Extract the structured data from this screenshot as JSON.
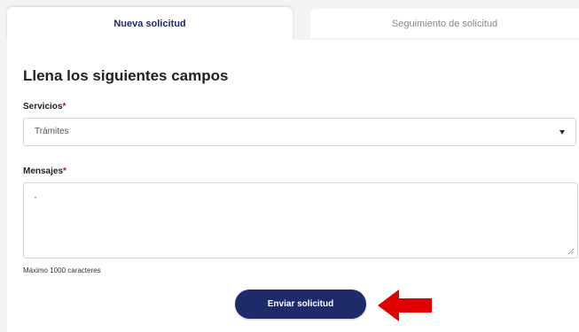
{
  "tabs": {
    "new_request": "Nueva solicitud",
    "tracking": "Seguimiento de solicitud"
  },
  "form": {
    "heading": "Llena los siguientes campos",
    "services": {
      "label": "Servicios",
      "required_mark": "*",
      "selected": "Trámites"
    },
    "messages": {
      "label": "Mensajes",
      "required_mark": "*",
      "value": "",
      "helper": "Máximo 1000 caracteres"
    },
    "submit_label": "Enviar solicitud"
  },
  "icons": {
    "select_arrow": "chevron-down-icon",
    "pointer": "red-arrow-left-icon"
  },
  "colors": {
    "primary": "#1f2a6b",
    "required": "#d0021b",
    "annotation_arrow": "#e00000"
  }
}
